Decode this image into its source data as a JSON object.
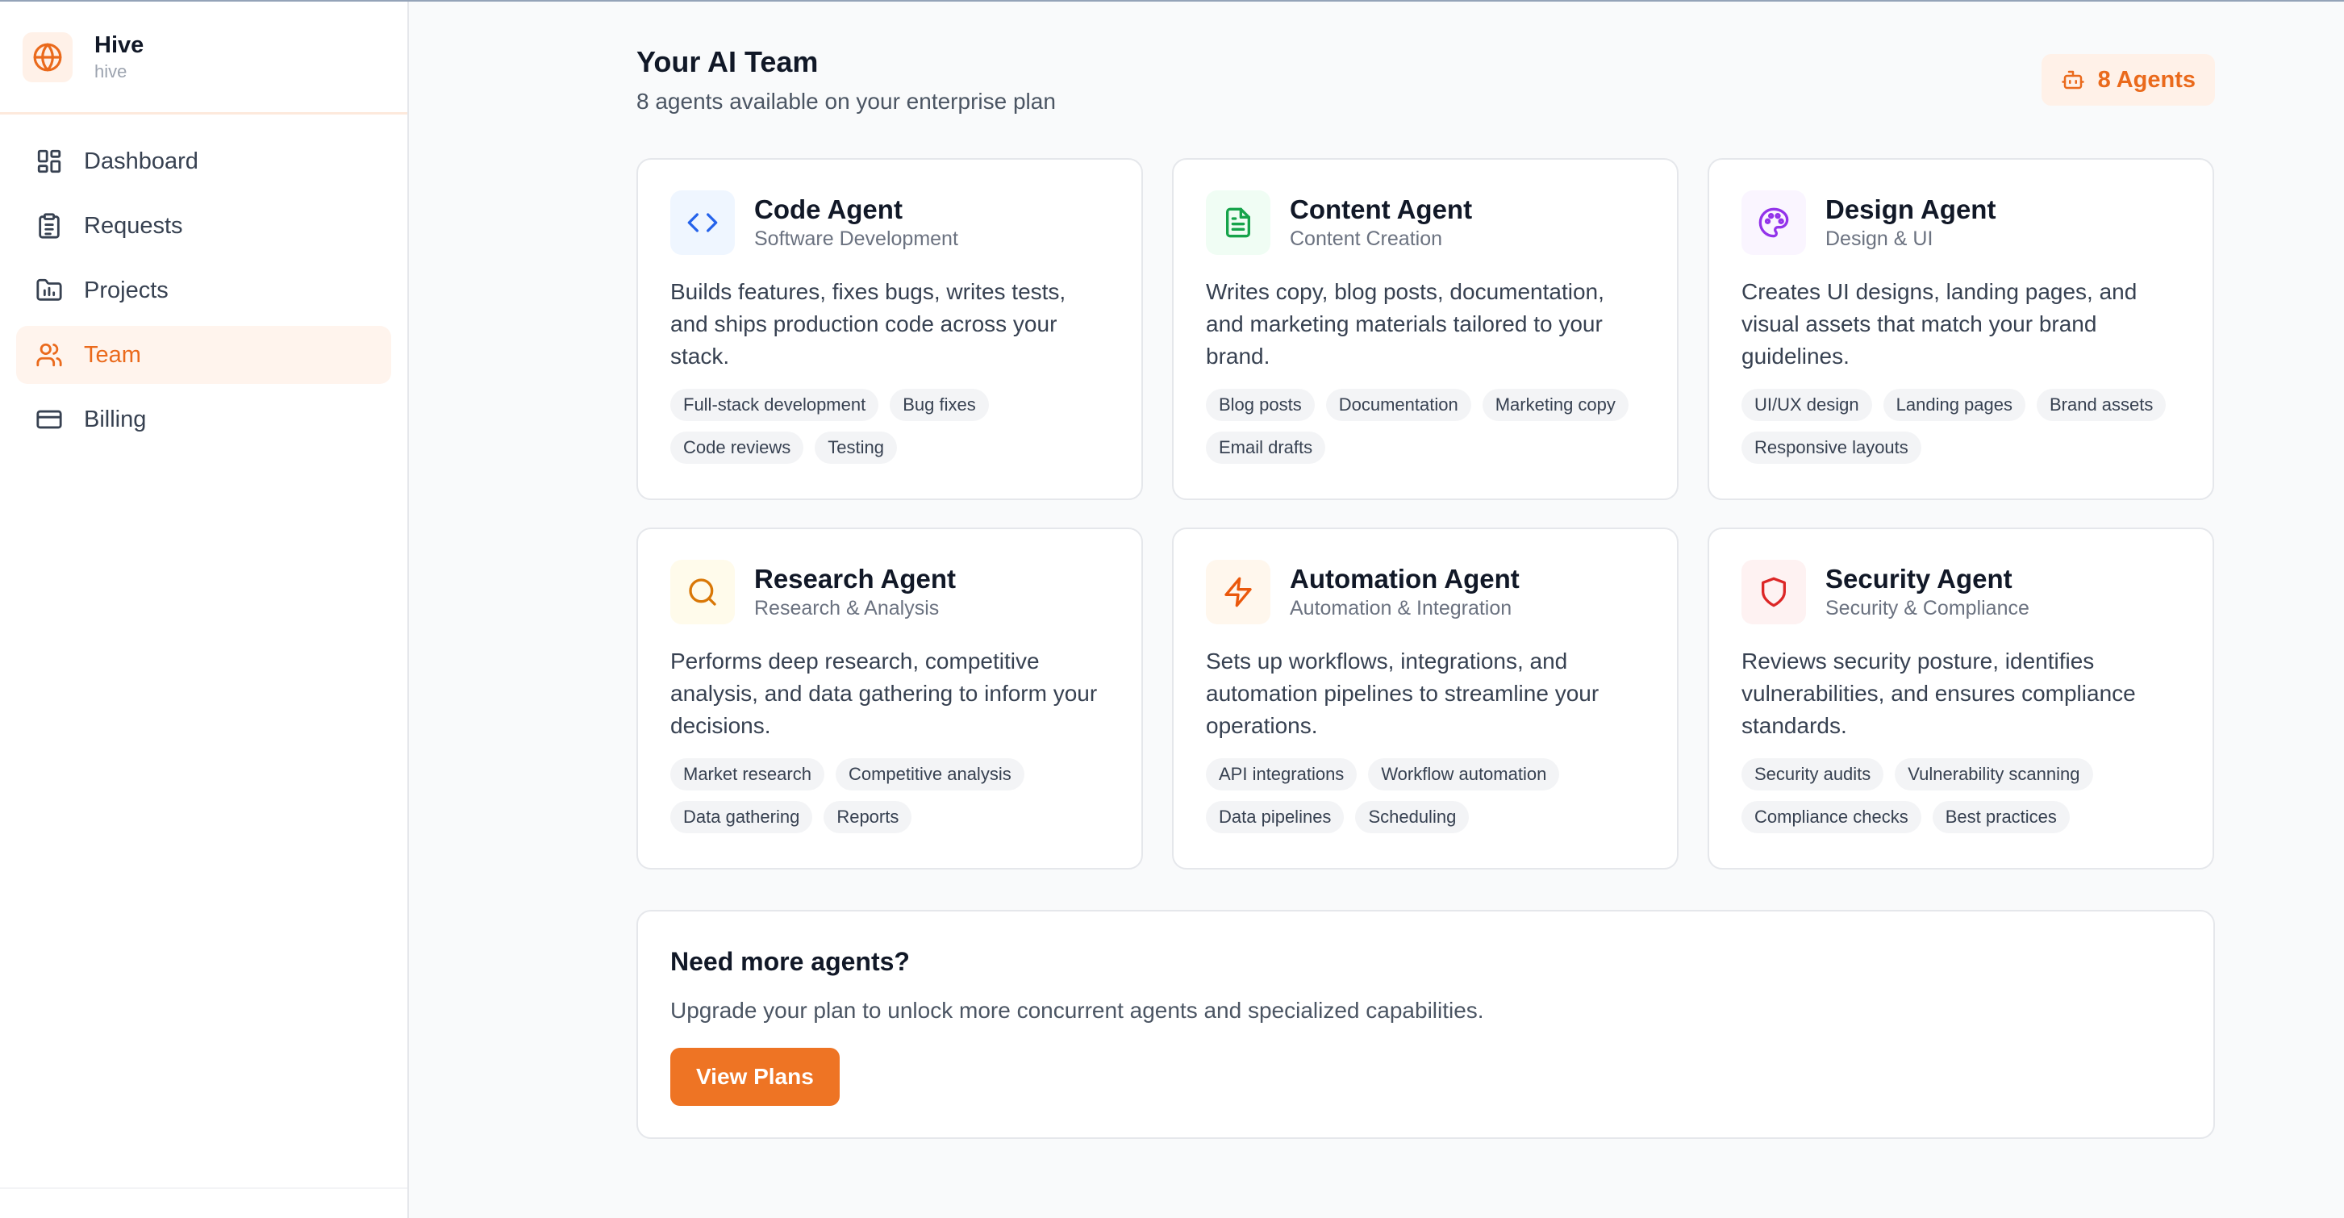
{
  "brand": {
    "name": "Hive",
    "sub": "hive",
    "icon": "globe-icon",
    "accent": "#ea6a1c"
  },
  "nav": [
    {
      "label": "Dashboard",
      "icon": "dashboard-icon"
    },
    {
      "label": "Requests",
      "icon": "clipboard-icon"
    },
    {
      "label": "Projects",
      "icon": "folder-icon"
    },
    {
      "label": "Team",
      "icon": "users-icon",
      "active": true
    },
    {
      "label": "Billing",
      "icon": "credit-card-icon"
    }
  ],
  "header": {
    "title": "Your AI Team",
    "subtitle": "8 agents available on your enterprise plan",
    "badge": "8 Agents",
    "badge_icon": "bot-icon"
  },
  "agents": [
    {
      "title": "Code Agent",
      "subtitle": "Software Development",
      "icon": "code-icon",
      "icon_color": "#2563eb",
      "icon_bg": "#eff6ff",
      "description": "Builds features, fixes bugs, writes tests, and ships production code across your stack.",
      "tags": [
        "Full-stack development",
        "Bug fixes",
        "Code reviews",
        "Testing"
      ]
    },
    {
      "title": "Content Agent",
      "subtitle": "Content Creation",
      "icon": "document-icon",
      "icon_color": "#16a34a",
      "icon_bg": "#f0fdf4",
      "description": "Writes copy, blog posts, documentation, and marketing materials tailored to your brand.",
      "tags": [
        "Blog posts",
        "Documentation",
        "Marketing copy",
        "Email drafts"
      ]
    },
    {
      "title": "Design Agent",
      "subtitle": "Design & UI",
      "icon": "palette-icon",
      "icon_color": "#9333ea",
      "icon_bg": "#faf5ff",
      "description": "Creates UI designs, landing pages, and visual assets that match your brand guidelines.",
      "tags": [
        "UI/UX design",
        "Landing pages",
        "Brand assets",
        "Responsive layouts"
      ]
    },
    {
      "title": "Research Agent",
      "subtitle": "Research & Analysis",
      "icon": "search-icon",
      "icon_color": "#d97706",
      "icon_bg": "#fffbeb",
      "description": "Performs deep research, competitive analysis, and data gathering to inform your decisions.",
      "tags": [
        "Market research",
        "Competitive analysis",
        "Data gathering",
        "Reports"
      ]
    },
    {
      "title": "Automation Agent",
      "subtitle": "Automation & Integration",
      "icon": "lightning-icon",
      "icon_color": "#ea580c",
      "icon_bg": "#fff7ed",
      "description": "Sets up workflows, integrations, and automation pipelines to streamline your operations.",
      "tags": [
        "API integrations",
        "Workflow automation",
        "Data pipelines",
        "Scheduling"
      ]
    },
    {
      "title": "Security Agent",
      "subtitle": "Security & Compliance",
      "icon": "shield-icon",
      "icon_color": "#dc2626",
      "icon_bg": "#fef2f2",
      "description": "Reviews security posture, identifies vulnerabilities, and ensures compliance standards.",
      "tags": [
        "Security audits",
        "Vulnerability scanning",
        "Compliance checks",
        "Best practices"
      ]
    }
  ],
  "upsell": {
    "title": "Need more agents?",
    "text": "Upgrade your plan to unlock more concurrent agents and specialized capabilities.",
    "button": "View Plans"
  }
}
